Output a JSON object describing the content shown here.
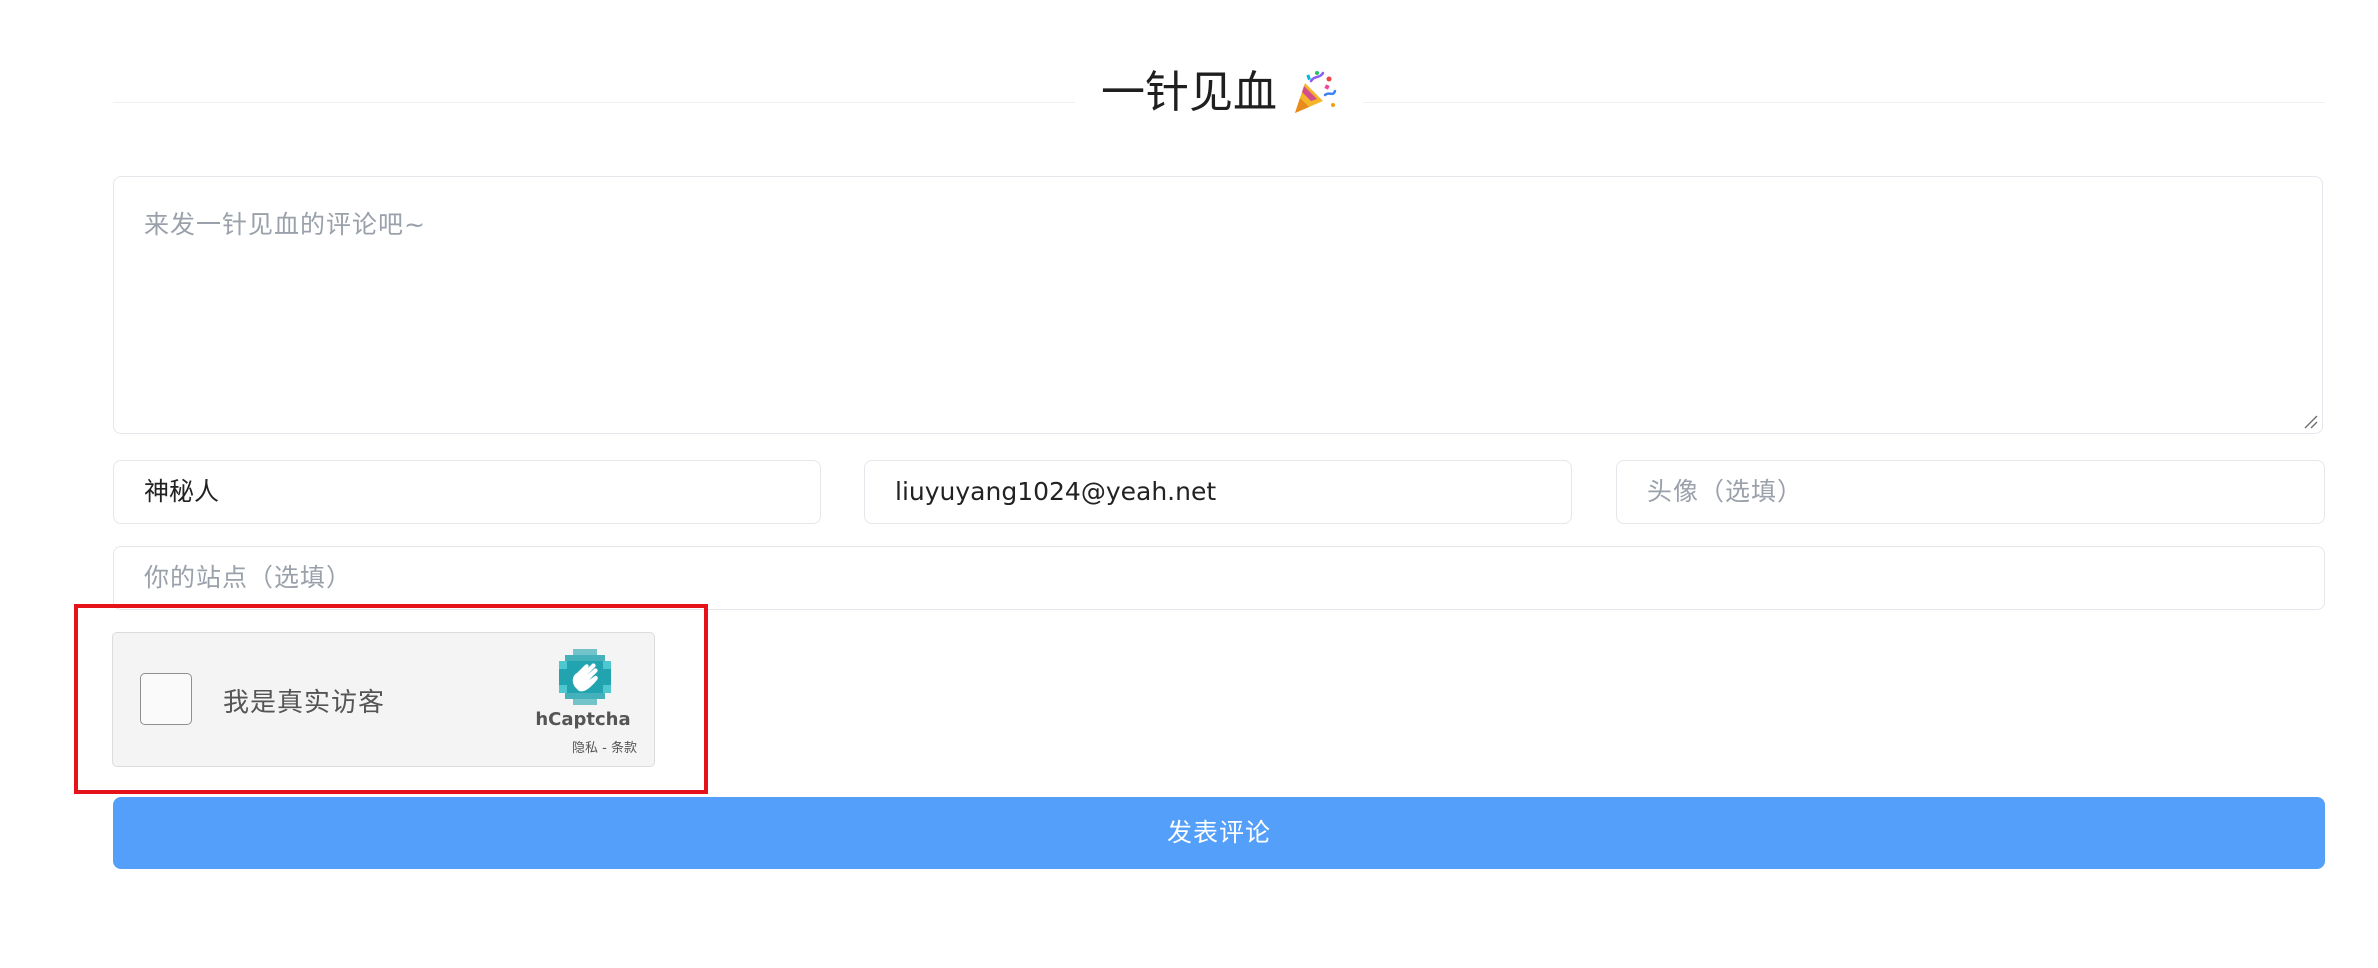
{
  "header": {
    "title": "一针见血",
    "title_icon": "party-popper-icon"
  },
  "comment": {
    "placeholder": "来发一针见血的评论吧~",
    "value": ""
  },
  "fields": {
    "nickname_value": "神秘人",
    "email_value": "liuyuyang1024@yeah.net",
    "avatar_placeholder": "头像（选填）",
    "site_placeholder": "你的站点（选填）"
  },
  "captcha": {
    "label": "我是真实访客",
    "brand": "hCaptcha",
    "privacy_link": "隐私",
    "separator": "-",
    "terms_link": "条款",
    "checked": false
  },
  "submit": {
    "label": "发表评论"
  },
  "colors": {
    "accent": "#539ff9",
    "highlight": "#e5121a",
    "placeholder": "#9aa1ab",
    "border": "#e4e7eb"
  }
}
